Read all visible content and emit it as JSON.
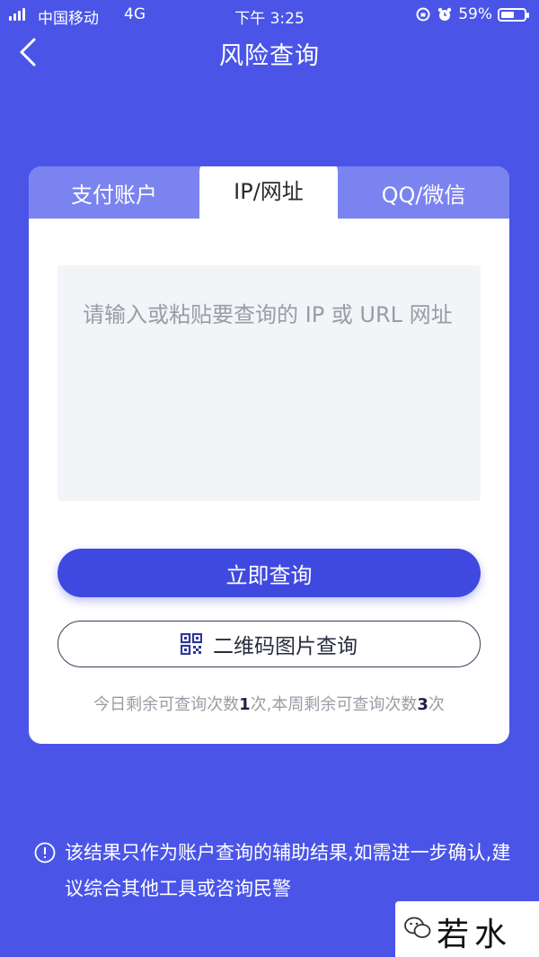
{
  "status_bar": {
    "carrier": "中国移动",
    "network": "4G",
    "time": "下午 3:25",
    "battery": "59%",
    "battery_level": 0.59
  },
  "nav": {
    "title": "风险查询"
  },
  "tabs": [
    {
      "label": "支付账户",
      "active": false
    },
    {
      "label": "IP/网址",
      "active": true
    },
    {
      "label": "QQ/微信",
      "active": false
    }
  ],
  "input": {
    "placeholder": "请输入或粘贴要查询的 IP 或 URL 网址"
  },
  "buttons": {
    "query": "立即查询",
    "qr_query": "二维码图片查询"
  },
  "quota": {
    "prefix": "今日剩余可查询次数",
    "today_count": "1",
    "middle": "次,本周剩余可查询次数",
    "week_count": "3",
    "suffix": "次"
  },
  "disclaimer": "该结果只作为账户查询的辅助结果,如需进一步确认,建议综合其他工具或咨询民警",
  "watermark": "若水网",
  "colors": {
    "background": "#4a55e8",
    "primary_button": "#3f49e0",
    "tab_bar": "#7b83f1"
  }
}
